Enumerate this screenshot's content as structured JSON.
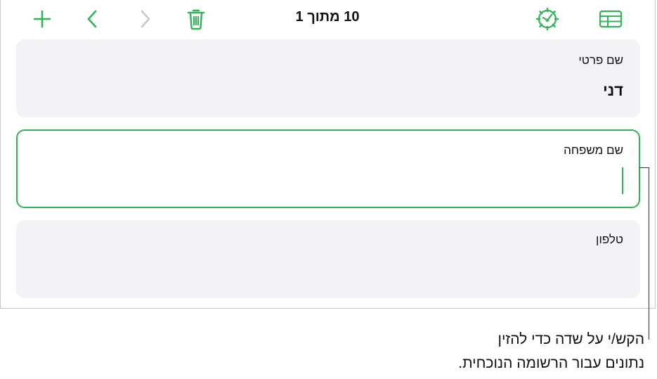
{
  "toolbar": {
    "record_counter": "10 מתוך 1",
    "icons": [
      "add-icon",
      "chevron-left-icon",
      "chevron-right-icon",
      "trash-icon",
      "settings-gear-icon",
      "table-view-icon"
    ],
    "accent_color": "#2fb457",
    "disabled_color": "#c7c7cc"
  },
  "fields": [
    {
      "label": "שם פרטי",
      "value": "דני"
    },
    {
      "label": "שם משפחה",
      "value": ""
    },
    {
      "label": "טלפון",
      "value": ""
    }
  ],
  "callout": {
    "line1": "הקש/י על שדה כדי להזין",
    "line2": "נתונים עבור הרשומה הנוכחית."
  }
}
